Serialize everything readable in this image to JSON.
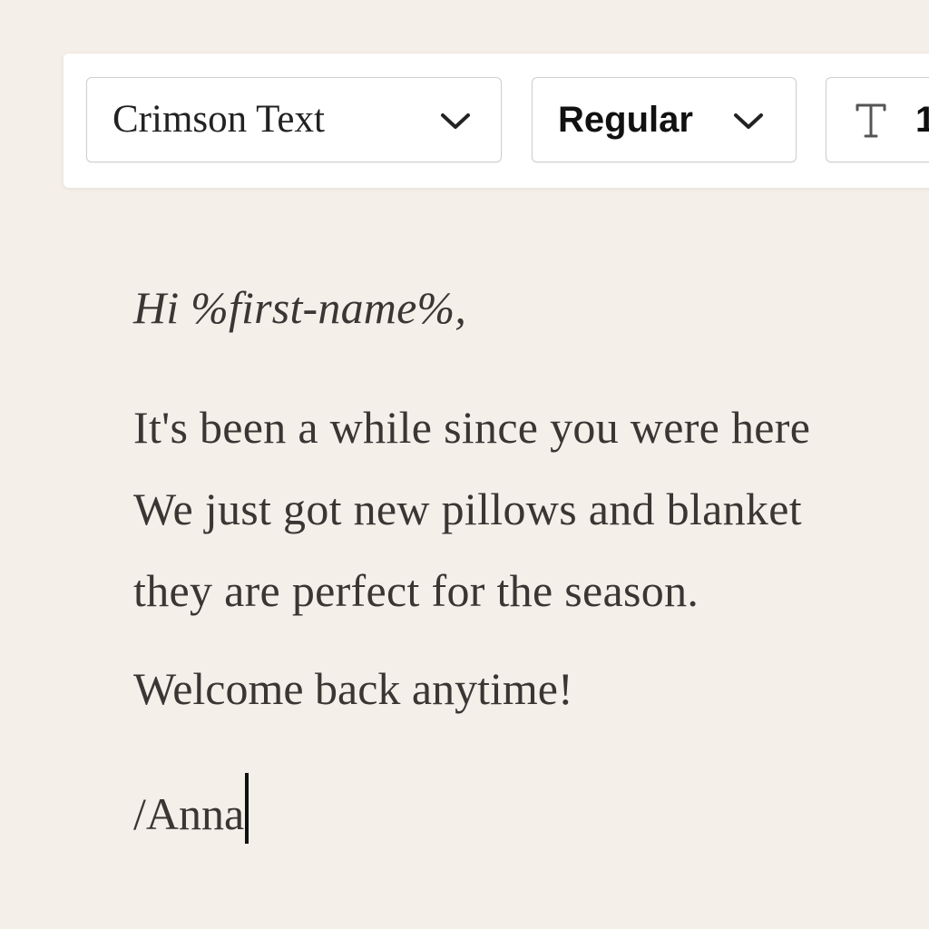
{
  "toolbar": {
    "font_family": {
      "selected": "Crimson Text",
      "icon": "chevron-down-icon"
    },
    "font_weight": {
      "selected": "Regular",
      "icon": "chevron-down-icon"
    },
    "font_size": {
      "icon": "text-size-icon",
      "value": "1"
    }
  },
  "editor": {
    "greeting": "Hi %first-name%,",
    "body_lines": [
      "It's been a while since you were here",
      "We just got new pillows and blanket",
      "they are perfect for the season."
    ],
    "closing": "Welcome back anytime!",
    "signature": "/Anna"
  },
  "colors": {
    "page_background": "#f4efe8",
    "editor_text": "#393634",
    "toolbar_background": "#ffffff"
  }
}
